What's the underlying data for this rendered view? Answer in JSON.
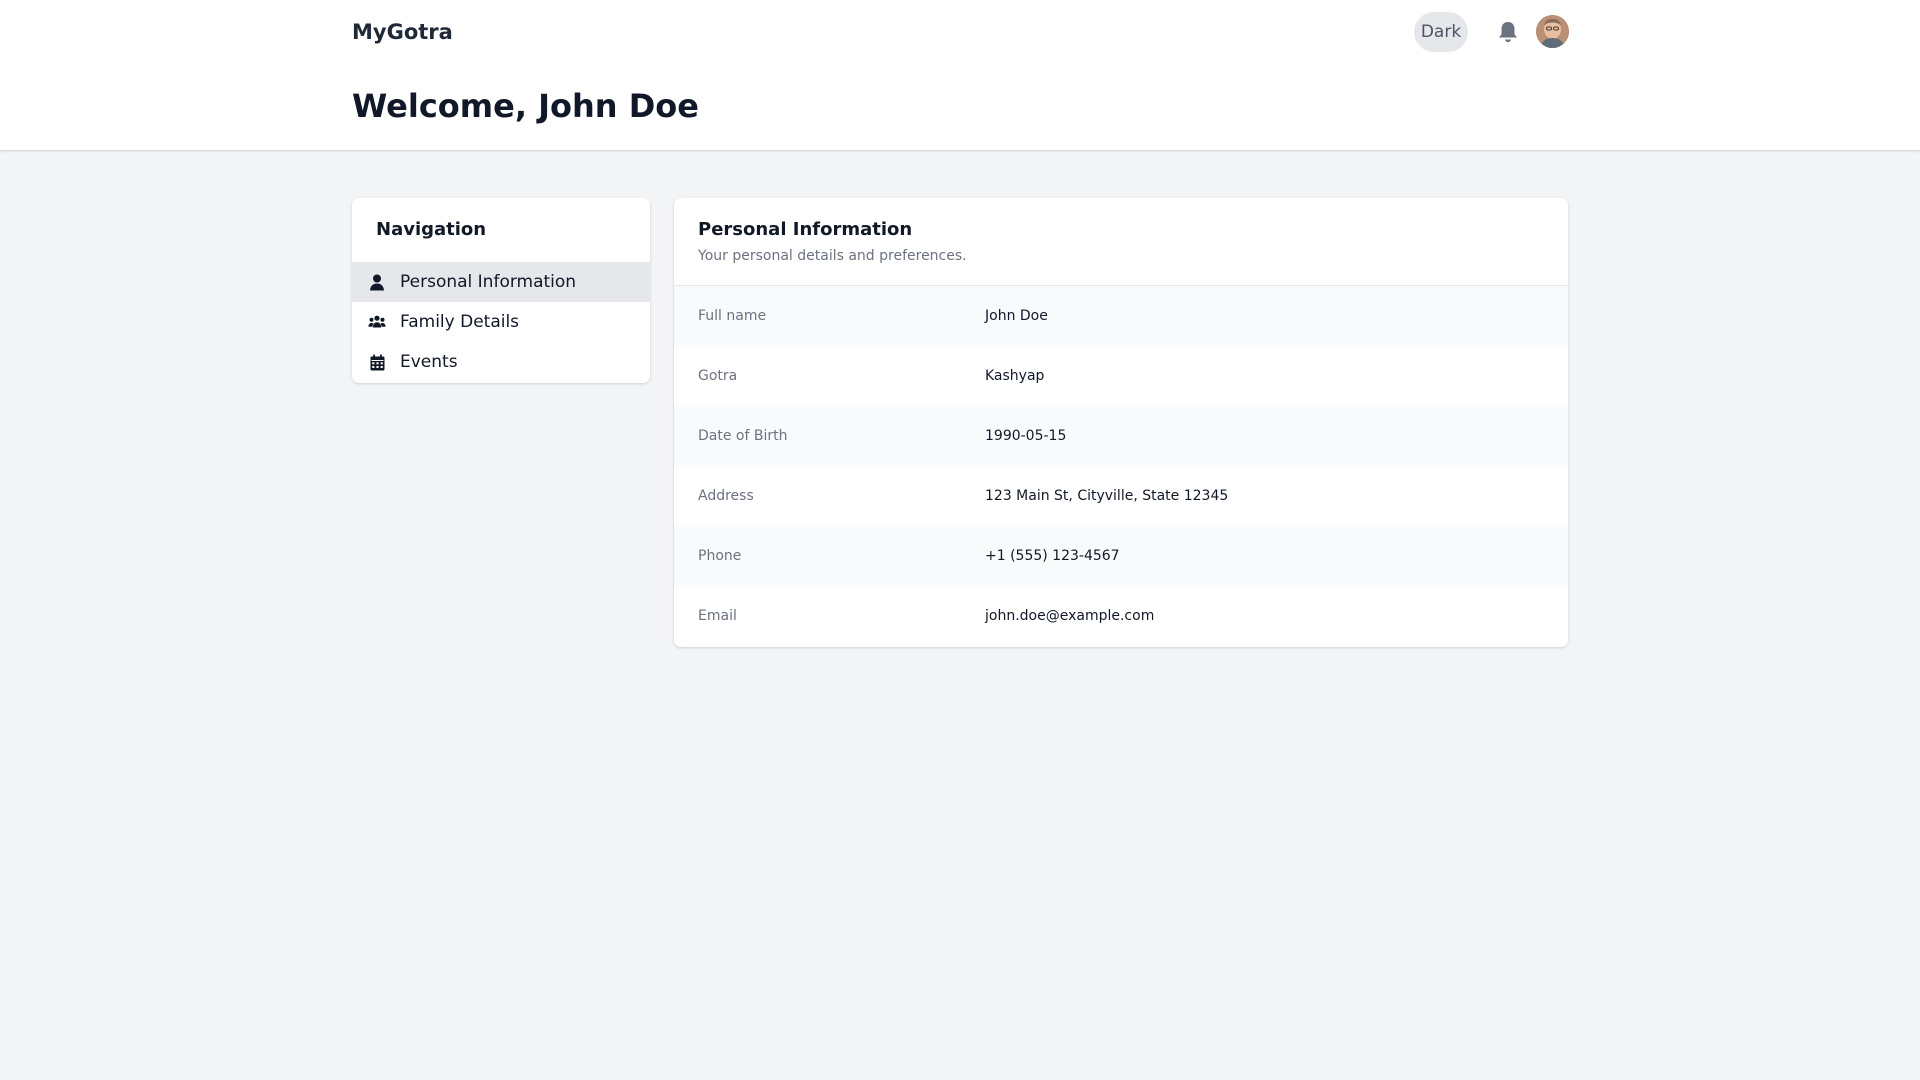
{
  "header": {
    "brand": "MyGotra",
    "theme_toggle_label": "Dark",
    "bell_icon": "bell-icon",
    "avatar_icon": "user-avatar",
    "page_title": "Welcome, John Doe"
  },
  "navigation": {
    "heading": "Navigation",
    "items": [
      {
        "label": "Personal Information",
        "icon": "user-icon",
        "active": true
      },
      {
        "label": "Family Details",
        "icon": "users-icon",
        "active": false
      },
      {
        "label": "Events",
        "icon": "calendar-icon",
        "active": false
      }
    ]
  },
  "personal_info": {
    "title": "Personal Information",
    "subtitle": "Your personal details and preferences.",
    "rows": [
      {
        "label": "Full name",
        "value": "John Doe"
      },
      {
        "label": "Gotra",
        "value": "Kashyap"
      },
      {
        "label": "Date of Birth",
        "value": "1990-05-15"
      },
      {
        "label": "Address",
        "value": "123 Main St, Cityville, State 12345"
      },
      {
        "label": "Phone",
        "value": "+1 (555) 123-4567"
      },
      {
        "label": "Email",
        "value": "john.doe@example.com"
      }
    ]
  },
  "colors": {
    "background": "#f3f4f6",
    "card": "#ffffff",
    "active_nav": "#e5e7eb",
    "muted_text": "#6b7280",
    "text": "#111827"
  }
}
